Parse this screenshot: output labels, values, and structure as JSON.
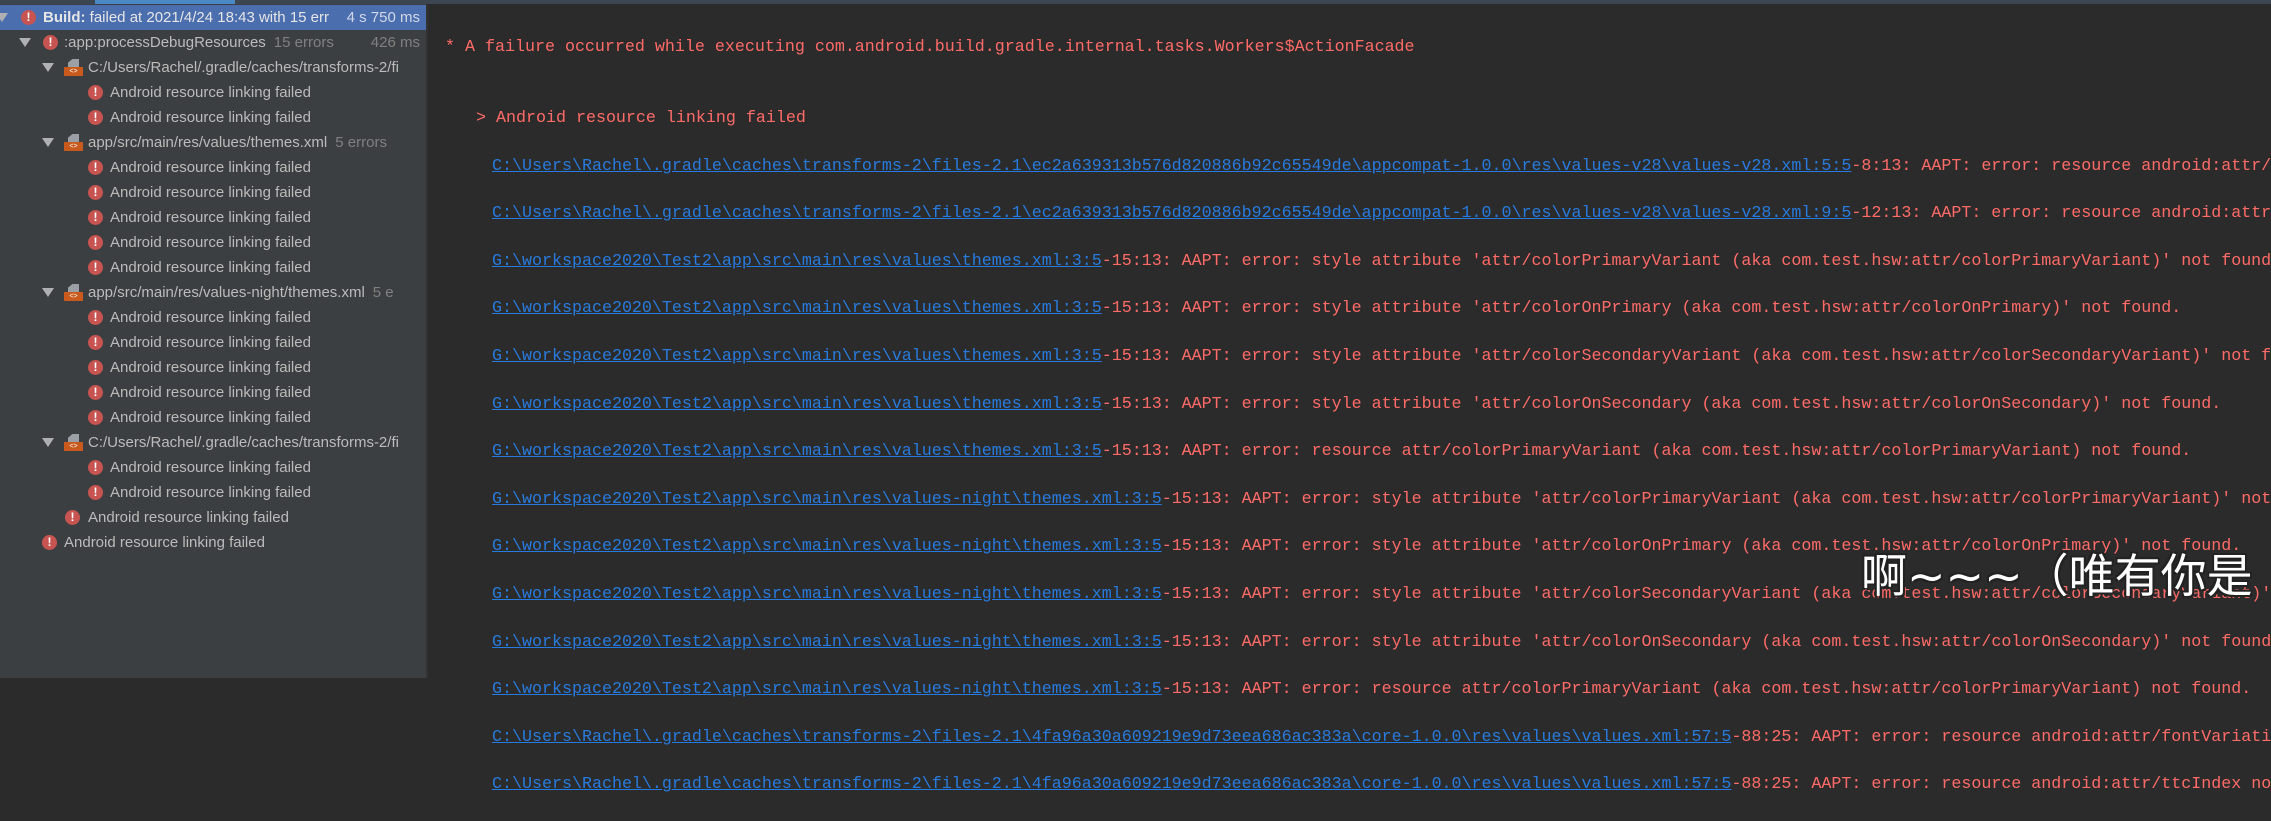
{
  "colors": {
    "sidebar_bg": "#3c3f41",
    "selected_bg": "#4b6eaf",
    "console_bg": "#2b2b2b",
    "error_text": "#ff6b68",
    "link": "#287bde",
    "error_icon": "#c75450"
  },
  "tree": {
    "build": {
      "label_bold": "Build:",
      "label": " failed at 2021/4/24 18:43 with 15 err",
      "time": "4 s 750 ms",
      "icon": "error-icon"
    },
    "task": {
      "label": ":app:processDebugResources",
      "count": "15 errors",
      "time": "426 ms"
    },
    "groups": [
      {
        "label": "C:/Users/Rachel/.gradle/caches/transforms-2/fi",
        "count": "",
        "items": [
          "Android resource linking failed",
          "Android resource linking failed"
        ]
      },
      {
        "label": "app/src/main/res/values/themes.xml",
        "count": "5 errors",
        "items": [
          "Android resource linking failed",
          "Android resource linking failed",
          "Android resource linking failed",
          "Android resource linking failed",
          "Android resource linking failed"
        ]
      },
      {
        "label": "app/src/main/res/values-night/themes.xml",
        "count": "5 e",
        "items": [
          "Android resource linking failed",
          "Android resource linking failed",
          "Android resource linking failed",
          "Android resource linking failed",
          "Android resource linking failed"
        ]
      },
      {
        "label": "C:/Users/Rachel/.gradle/caches/transforms-2/fi",
        "count": "",
        "items": [
          "Android resource linking failed",
          "Android resource linking failed"
        ]
      }
    ],
    "task_item": "Android resource linking failed",
    "root_item": "Android resource linking failed"
  },
  "console": {
    "header": "* A failure occurred while executing com.android.build.gradle.internal.tasks.Workers$ActionFacade",
    "cause": "> Android resource linking failed",
    "entries": [
      {
        "link": "C:\\Users\\Rachel\\.gradle\\caches\\transforms-2\\files-2.1\\ec2a639313b576d820886b92c65549de\\appcompat-1.0.0\\res\\values-v28\\values-v28.xml:5:5",
        "msg": "-8:13: AAPT: error: resource android:attr/"
      },
      {
        "link": "C:\\Users\\Rachel\\.gradle\\caches\\transforms-2\\files-2.1\\ec2a639313b576d820886b92c65549de\\appcompat-1.0.0\\res\\values-v28\\values-v28.xml:9:5",
        "msg": "-12:13: AAPT: error: resource android:attr"
      },
      {
        "link": "G:\\workspace2020\\Test2\\app\\src\\main\\res\\values\\themes.xml:3:5",
        "msg": "-15:13: AAPT: error: style attribute 'attr/colorPrimaryVariant (aka com.test.hsw:attr/colorPrimaryVariant)' not found"
      },
      {
        "link": "G:\\workspace2020\\Test2\\app\\src\\main\\res\\values\\themes.xml:3:5",
        "msg": "-15:13: AAPT: error: style attribute 'attr/colorOnPrimary (aka com.test.hsw:attr/colorOnPrimary)' not found."
      },
      {
        "link": "G:\\workspace2020\\Test2\\app\\src\\main\\res\\values\\themes.xml:3:5",
        "msg": "-15:13: AAPT: error: style attribute 'attr/colorSecondaryVariant (aka com.test.hsw:attr/colorSecondaryVariant)' not f"
      },
      {
        "link": "G:\\workspace2020\\Test2\\app\\src\\main\\res\\values\\themes.xml:3:5",
        "msg": "-15:13: AAPT: error: style attribute 'attr/colorOnSecondary (aka com.test.hsw:attr/colorOnSecondary)' not found."
      },
      {
        "link": "G:\\workspace2020\\Test2\\app\\src\\main\\res\\values\\themes.xml:3:5",
        "msg": "-15:13: AAPT: error: resource attr/colorPrimaryVariant (aka com.test.hsw:attr/colorPrimaryVariant) not found."
      },
      {
        "link": "G:\\workspace2020\\Test2\\app\\src\\main\\res\\values-night\\themes.xml:3:5",
        "msg": "-15:13: AAPT: error: style attribute 'attr/colorPrimaryVariant (aka com.test.hsw:attr/colorPrimaryVariant)' not"
      },
      {
        "link": "G:\\workspace2020\\Test2\\app\\src\\main\\res\\values-night\\themes.xml:3:5",
        "msg": "-15:13: AAPT: error: style attribute 'attr/colorOnPrimary (aka com.test.hsw:attr/colorOnPrimary)' not found."
      },
      {
        "link": "G:\\workspace2020\\Test2\\app\\src\\main\\res\\values-night\\themes.xml:3:5",
        "msg": "-15:13: AAPT: error: style attribute 'attr/colorSecondaryVariant (aka com.test.hsw:attr/colorSecondaryVariant)'"
      },
      {
        "link": "G:\\workspace2020\\Test2\\app\\src\\main\\res\\values-night\\themes.xml:3:5",
        "msg": "-15:13: AAPT: error: style attribute 'attr/colorOnSecondary (aka com.test.hsw:attr/colorOnSecondary)' not found"
      },
      {
        "link": "G:\\workspace2020\\Test2\\app\\src\\main\\res\\values-night\\themes.xml:3:5",
        "msg": "-15:13: AAPT: error: resource attr/colorPrimaryVariant (aka com.test.hsw:attr/colorPrimaryVariant) not found."
      },
      {
        "link": "C:\\Users\\Rachel\\.gradle\\caches\\transforms-2\\files-2.1\\4fa96a30a609219e9d73eea686ac383a\\core-1.0.0\\res\\values\\values.xml:57:5",
        "msg": "-88:25: AAPT: error: resource android:attr/fontVariati"
      },
      {
        "link": "C:\\Users\\Rachel\\.gradle\\caches\\transforms-2\\files-2.1\\4fa96a30a609219e9d73eea686ac383a\\core-1.0.0\\res\\values\\values.xml:57:5",
        "msg": "-88:25: AAPT: error: resource android:attr/ttcIndex no"
      }
    ]
  },
  "subtitle": "啊~~~（唯有你是"
}
